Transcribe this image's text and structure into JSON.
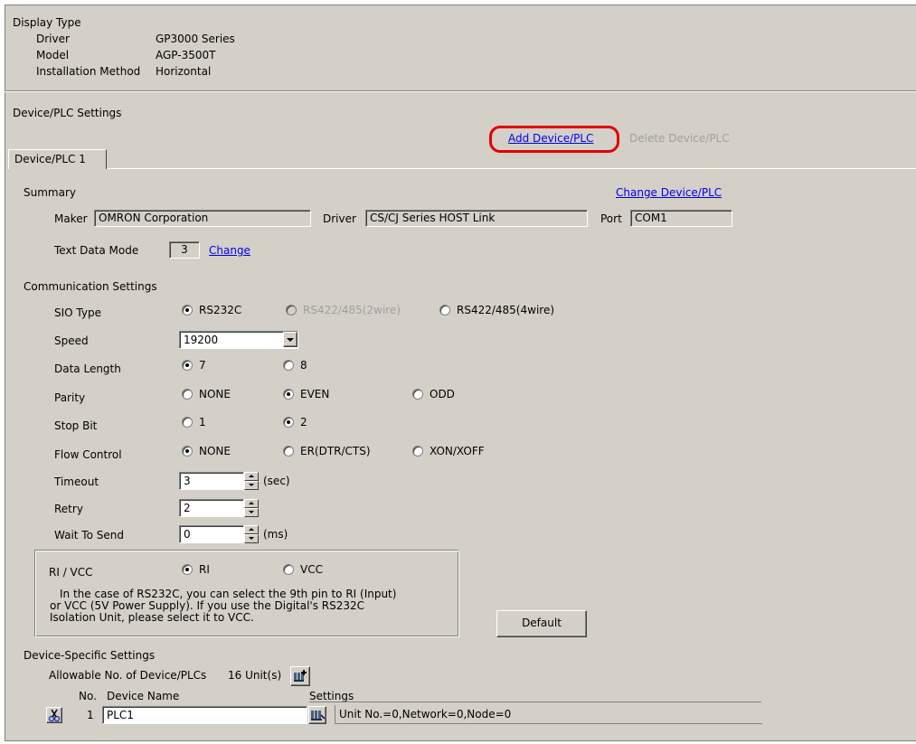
{
  "display_type": {
    "heading": "Display Type",
    "rows": [
      {
        "label": "Driver",
        "value": "GP3000 Series"
      },
      {
        "label": "Model",
        "value": "AGP-3500T"
      },
      {
        "label": "Installation Method",
        "value": "Horizontal"
      }
    ]
  },
  "device_settings": {
    "heading": "Device/PLC Settings",
    "add_link": "Add Device/PLC",
    "delete_link": "Delete Device/PLC",
    "highlight_color": "#e00000",
    "tab": "Device/PLC 1"
  },
  "summary": {
    "heading": "Summary",
    "change_device_link": "Change Device/PLC",
    "maker_label": "Maker",
    "maker_value": "OMRON Corporation",
    "driver_label": "Driver",
    "driver_value": "CS/CJ Series HOST Link",
    "port_label": "Port",
    "port_value": "COM1",
    "text_mode_label": "Text Data Mode",
    "text_mode_value": "3",
    "change_link": "Change"
  },
  "comm": {
    "heading": "Communication Settings",
    "sio_label": "SIO Type",
    "sio_options": [
      "RS232C",
      "RS422/485(2wire)",
      "RS422/485(4wire)"
    ],
    "sio_selected": "RS232C",
    "speed_label": "Speed",
    "speed_value": "19200",
    "data_length_label": "Data Length",
    "data_length_options": [
      "7",
      "8"
    ],
    "data_length_selected": "7",
    "parity_label": "Parity",
    "parity_options": [
      "NONE",
      "EVEN",
      "ODD"
    ],
    "parity_selected": "EVEN",
    "stop_bit_label": "Stop Bit",
    "stop_bit_options": [
      "1",
      "2"
    ],
    "stop_bit_selected": "2",
    "flow_label": "Flow Control",
    "flow_options": [
      "NONE",
      "ER(DTR/CTS)",
      "XON/XOFF"
    ],
    "flow_selected": "NONE",
    "timeout_label": "Timeout",
    "timeout_value": "3",
    "timeout_unit": "(sec)",
    "retry_label": "Retry",
    "retry_value": "2",
    "wait_label": "Wait To Send",
    "wait_value": "0",
    "wait_unit": "(ms)"
  },
  "rivcc": {
    "label": "RI / VCC",
    "options": [
      "RI",
      "VCC"
    ],
    "selected": "RI",
    "note_line1": "In the case of RS232C, you can select the 9th pin to RI (Input)",
    "note_line2": "or VCC (5V Power Supply). If you use the Digital's RS232C",
    "note_line3": "Isolation Unit, please select it to VCC.",
    "default_button": "Default"
  },
  "specific": {
    "heading": "Device-Specific Settings",
    "allowable_label": "Allowable No. of Device/PLCs",
    "allowable_value": "16 Unit(s)",
    "col_no": "No.",
    "col_name": "Device Name",
    "col_settings": "Settings",
    "row_no": "1",
    "row_name": "PLC1",
    "row_settings": "Unit No.=0,Network=0,Node=0"
  }
}
